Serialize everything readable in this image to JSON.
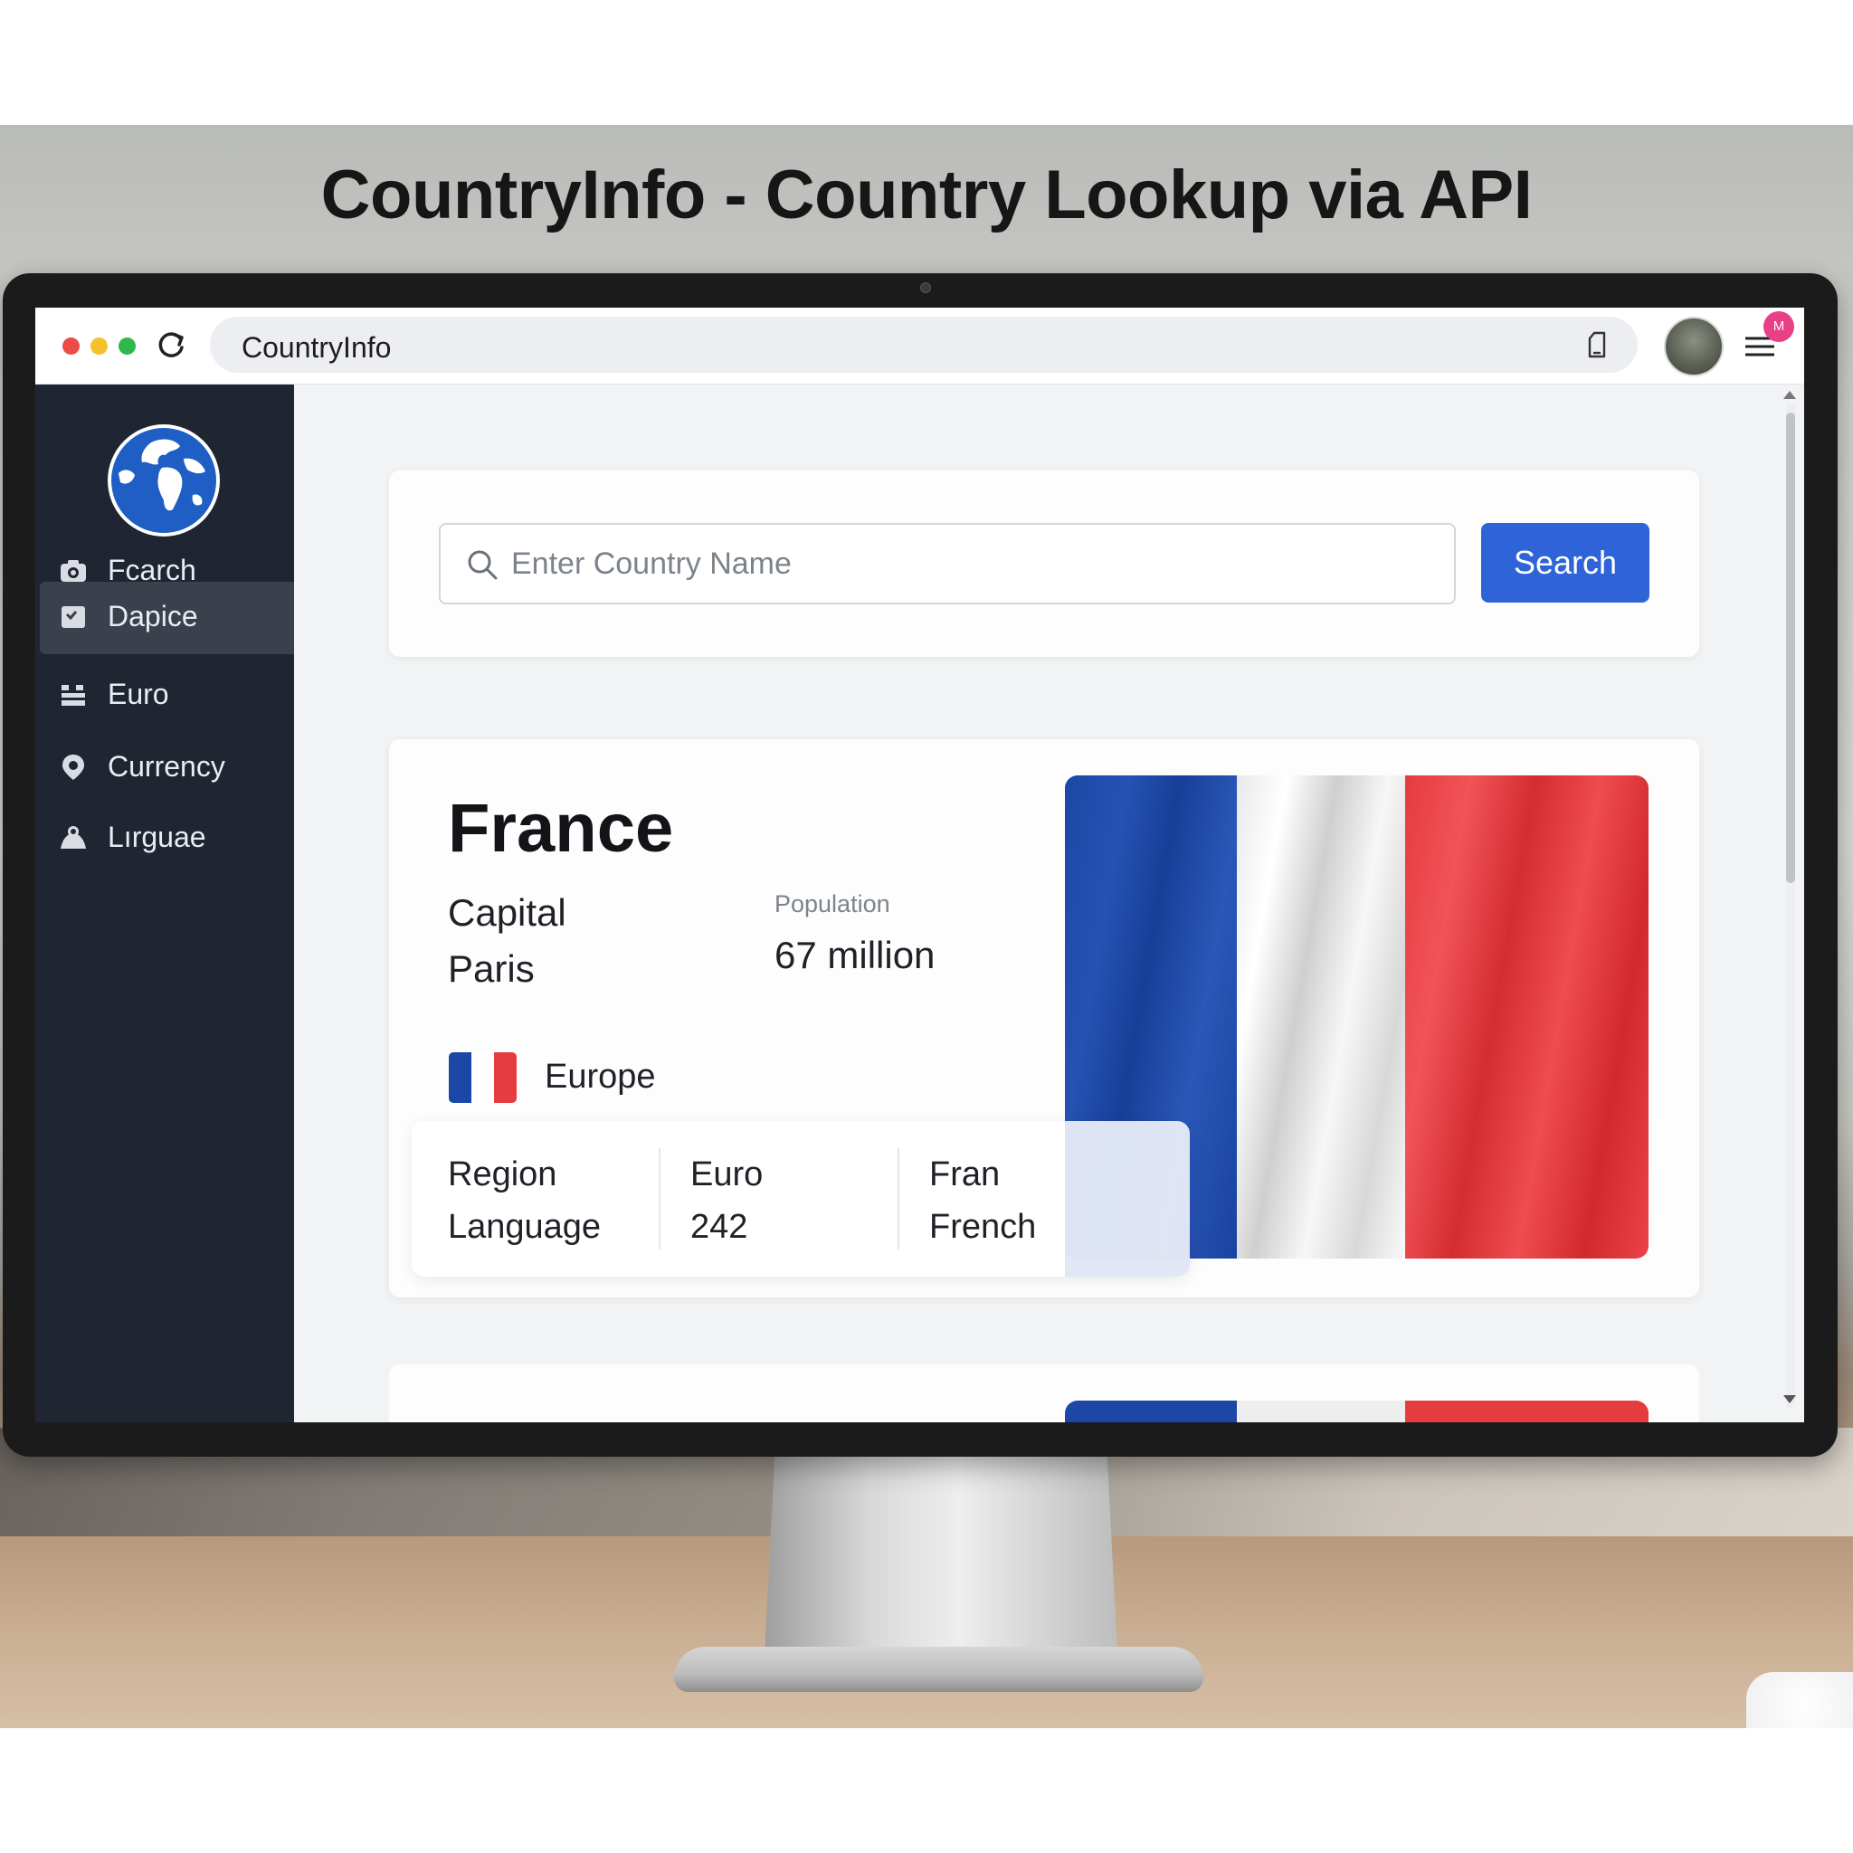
{
  "headline": "CountryInfo - Country Lookup via API",
  "browser": {
    "url_text": "CountryInfo",
    "notification_badge": "M"
  },
  "sidebar": {
    "items": [
      {
        "label": "Fcarch",
        "icon": "camera-icon",
        "active": false
      },
      {
        "label": "Dapice",
        "icon": "image-icon",
        "active": true
      },
      {
        "label": "Euro",
        "icon": "list-icon",
        "active": false
      },
      {
        "label": "Currency",
        "icon": "location-pin-icon",
        "active": false
      },
      {
        "label": "Lırguae",
        "icon": "person-icon",
        "active": false
      }
    ]
  },
  "search": {
    "placeholder": "Enter Country Name",
    "button_label": "Search"
  },
  "result": {
    "country_name": "France",
    "capital_label": "Capital",
    "capital_value": "Paris",
    "population_label": "Population",
    "population_value": "67 million",
    "continent": "Europe",
    "table": {
      "col1": [
        "Region",
        "Language"
      ],
      "col2": [
        "Euro",
        "242"
      ],
      "col3": [
        "Fran",
        "French"
      ]
    }
  },
  "colors": {
    "accent": "#2f64d8",
    "sidebar_bg": "#1f2632",
    "flag_blue": "#1c47a6",
    "flag_white": "#ffffff",
    "flag_red": "#e63b3f"
  }
}
